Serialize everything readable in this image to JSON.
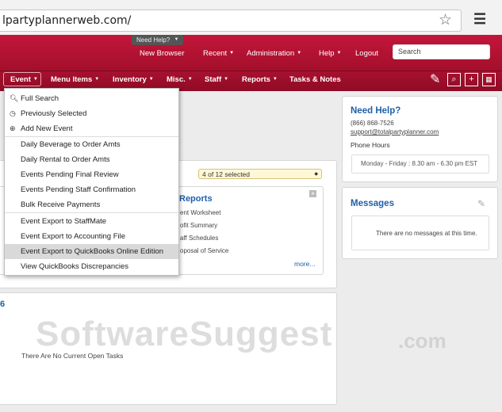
{
  "browser": {
    "url": "lpartyplannerweb.com/",
    "star_icon": "star-icon",
    "menu_icon": "hamburger-icon"
  },
  "header": {
    "need_help_badge": "Need Help?",
    "links": [
      "New Browser",
      "Recent",
      "Administration",
      "Help",
      "Logout"
    ],
    "search_placeholder": "Search"
  },
  "nav": {
    "items": [
      "Event",
      "Menu Items",
      "Inventory",
      "Misc.",
      "Staff",
      "Reports",
      "Tasks & Notes"
    ]
  },
  "dropdown": {
    "items": [
      {
        "label": "Full Search",
        "icon": "search-icon"
      },
      {
        "label": "Previously Selected",
        "icon": "clock-icon"
      },
      {
        "label": "Add New Event",
        "icon": "plus-circle-icon"
      },
      {
        "label": "Daily Beverage to Order Amts"
      },
      {
        "label": "Daily Rental to Order Amts"
      },
      {
        "label": "Events Pending Final Review"
      },
      {
        "label": "Events Pending Staff Confirmation"
      },
      {
        "label": "Bulk Receive Payments"
      },
      {
        "label": "Event Export to StaffMate"
      },
      {
        "label": "Event Export to Accounting File"
      },
      {
        "label": "Event Export to QuickBooks Online Edition"
      },
      {
        "label": "View QuickBooks Discrepancies"
      }
    ]
  },
  "main": {
    "selected_dropdown": "4 of 12 selected",
    "reports_title": "Reports",
    "report_lines": [
      "ent Worksheet",
      "ofit Summary",
      "aff Schedules",
      "oposal of Service"
    ],
    "more_link": "more...",
    "tasks_num": "6",
    "no_tasks": "There Are No Current Open Tasks"
  },
  "help_panel": {
    "title": "Need Help?",
    "phone": "(866) 868-7526",
    "email": "support@totalpartyplanner.com",
    "hours_label": "Phone Hours",
    "hours": "Monday - Friday : 8.30 am - 6.30 pm EST"
  },
  "messages_panel": {
    "title": "Messages",
    "empty": "There are no messages at this time."
  },
  "watermark": {
    "main": "SoftwareSuggest",
    "suffix": ".com"
  }
}
